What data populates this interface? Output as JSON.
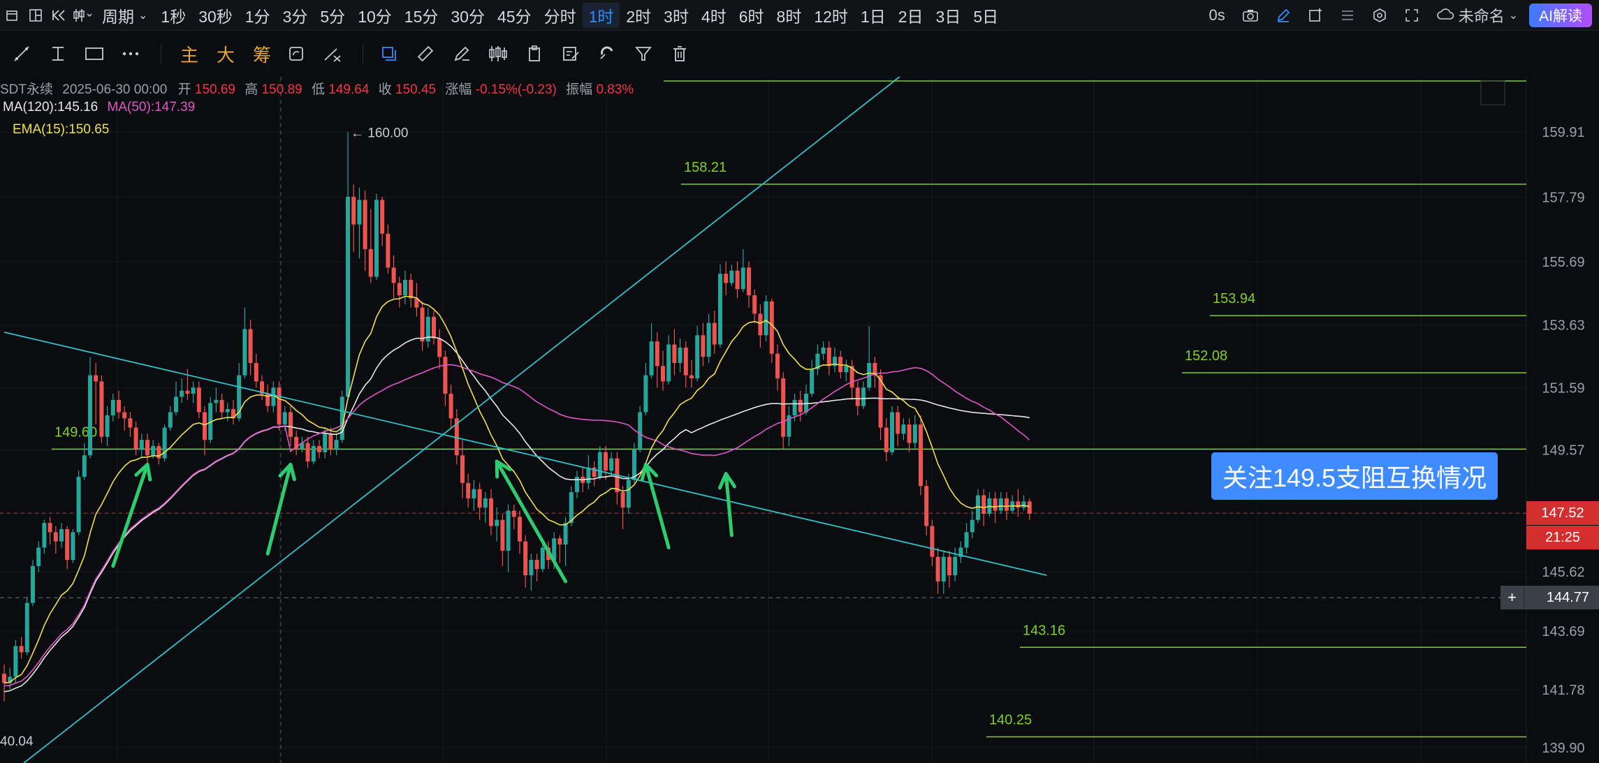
{
  "toolbar": {
    "period_label": "周期",
    "timeframes": [
      "1秒",
      "30秒",
      "1分",
      "3分",
      "5分",
      "10分",
      "15分",
      "30分",
      "45分",
      "分时",
      "1时",
      "2时",
      "3时",
      "4时",
      "6时",
      "8时",
      "12时",
      "1日",
      "2日",
      "3日",
      "5日"
    ],
    "active_timeframe": "1时",
    "latency": "0s",
    "layout_name": "未命名",
    "ai_button": "AI解读"
  },
  "drawbar": {
    "gold_labels": [
      "主",
      "大",
      "筹"
    ]
  },
  "legend": {
    "symbol": "SDT永续",
    "datetime": "2025-06-30 00:00",
    "open_label": "开",
    "open": "150.69",
    "high_label": "高",
    "high": "150.89",
    "low_label": "低",
    "low": "149.64",
    "close_label": "收",
    "close": "150.45",
    "change_label": "涨幅",
    "change": "-0.15%(-0.23)",
    "amp_label": "振幅",
    "amp": "0.83%",
    "ma120": "MA(120):145.16",
    "ma50": "MA(50):147.39",
    "ema15": "EMA(15):150.65"
  },
  "annotation": "关注149.5支阻互换情况",
  "badges": {
    "current_price": "147.52",
    "countdown": "21:25",
    "cursor_price": "144.77"
  },
  "colors": {
    "up": "#26a69a",
    "down": "#ef5350",
    "ma120": "#e8e8e8",
    "ma50": "#e056c8",
    "ema15": "#f0e14c",
    "level_line": "#7ed321",
    "trend_line": "#2fc2c9",
    "arrow": "#2ecc71"
  },
  "chart_data": {
    "type": "candlestick",
    "y_axis_ticks": [
      "159.91",
      "157.79",
      "155.69",
      "153.63",
      "151.59",
      "149.57",
      "147.52",
      "145.62",
      "143.69",
      "141.78",
      "139.90"
    ],
    "ylim": [
      139.4,
      161.7
    ],
    "high_marker": "160.00",
    "low_marker": "40.04",
    "levels": [
      {
        "label": "158.21",
        "value": 158.21
      },
      {
        "label": "153.94",
        "value": 153.94
      },
      {
        "label": "152.08",
        "value": 152.08
      },
      {
        "label": "149.60",
        "value": 149.6
      },
      {
        "label": "143.16",
        "value": 143.16
      },
      {
        "label": "140.25",
        "value": 140.25
      }
    ],
    "trend_lines": [
      {
        "from": [
          0,
          138.9
        ],
        "to": [
          157,
          161.8
        ]
      },
      {
        "from": [
          0,
          153.4
        ],
        "to": [
          182,
          145.5
        ]
      }
    ],
    "arrows": [
      {
        "from": [
          19,
          145.8
        ],
        "to": [
          25,
          149.1
        ]
      },
      {
        "from": [
          46,
          146.2
        ],
        "to": [
          50,
          149.1
        ]
      },
      {
        "from": [
          98,
          145.3
        ],
        "to": [
          86,
          149.2
        ]
      },
      {
        "from": [
          116,
          146.4
        ],
        "to": [
          112,
          149.1
        ]
      },
      {
        "from": [
          127,
          146.8
        ],
        "to": [
          126,
          148.8
        ]
      }
    ],
    "candles": [
      [
        142.3,
        142.0,
        141.4,
        142.6
      ],
      [
        142.0,
        142.2,
        141.8,
        142.5
      ],
      [
        142.2,
        143.2,
        142.0,
        143.4
      ],
      [
        143.2,
        143.0,
        142.8,
        143.5
      ],
      [
        143.0,
        144.6,
        142.9,
        144.8
      ],
      [
        144.6,
        145.8,
        144.5,
        146.0
      ],
      [
        145.8,
        146.4,
        145.6,
        146.6
      ],
      [
        146.4,
        147.2,
        146.2,
        147.3
      ],
      [
        147.2,
        146.9,
        146.5,
        147.4
      ],
      [
        146.9,
        146.6,
        146.2,
        147.1
      ],
      [
        146.6,
        147.0,
        146.4,
        147.2
      ],
      [
        147.0,
        146.0,
        145.7,
        147.1
      ],
      [
        146.0,
        146.9,
        145.9,
        147.0
      ],
      [
        146.9,
        148.7,
        146.8,
        148.9
      ],
      [
        148.7,
        149.4,
        148.6,
        149.8
      ],
      [
        149.4,
        152.0,
        149.3,
        152.6
      ],
      [
        152.0,
        151.8,
        150.4,
        152.4
      ],
      [
        151.8,
        150.0,
        149.8,
        152.0
      ],
      [
        150.0,
        150.7,
        149.7,
        151.0
      ],
      [
        150.7,
        151.2,
        150.5,
        151.4
      ],
      [
        151.2,
        150.8,
        150.6,
        151.5
      ],
      [
        150.8,
        150.6,
        150.2,
        151.0
      ],
      [
        150.6,
        150.3,
        150.0,
        150.8
      ],
      [
        150.3,
        149.6,
        149.4,
        150.5
      ],
      [
        149.6,
        149.9,
        149.3,
        150.1
      ],
      [
        149.9,
        149.4,
        149.1,
        150.1
      ],
      [
        149.4,
        149.7,
        149.3,
        149.9
      ],
      [
        149.7,
        149.3,
        149.1,
        149.8
      ],
      [
        149.3,
        150.3,
        149.2,
        150.4
      ],
      [
        150.3,
        150.8,
        150.2,
        151.0
      ],
      [
        150.8,
        151.3,
        150.7,
        151.8
      ],
      [
        151.3,
        151.5,
        151.1,
        151.9
      ],
      [
        151.5,
        151.4,
        151.2,
        152.2
      ],
      [
        151.4,
        151.6,
        151.1,
        151.8
      ],
      [
        151.6,
        150.8,
        150.6,
        151.8
      ],
      [
        150.8,
        149.9,
        149.4,
        151.0
      ],
      [
        149.9,
        151.1,
        149.8,
        151.3
      ],
      [
        151.1,
        151.2,
        150.8,
        151.6
      ],
      [
        151.2,
        150.8,
        150.6,
        151.4
      ],
      [
        150.8,
        150.9,
        150.5,
        151.1
      ],
      [
        150.9,
        150.6,
        150.4,
        151.2
      ],
      [
        150.6,
        152.0,
        150.5,
        152.4
      ],
      [
        152.0,
        153.5,
        151.9,
        154.2
      ],
      [
        153.5,
        152.4,
        152.0,
        153.8
      ],
      [
        152.4,
        151.8,
        151.6,
        152.7
      ],
      [
        151.8,
        151.4,
        151.2,
        152.0
      ],
      [
        151.4,
        151.0,
        150.8,
        151.7
      ],
      [
        151.0,
        151.6,
        150.8,
        151.8
      ],
      [
        151.6,
        150.4,
        150.2,
        151.8
      ],
      [
        150.4,
        150.8,
        150.2,
        151.0
      ],
      [
        150.8,
        150.0,
        149.7,
        151.0
      ],
      [
        150.0,
        149.6,
        149.4,
        150.2
      ],
      [
        149.6,
        149.8,
        149.5,
        150.0
      ],
      [
        149.8,
        149.2,
        149.0,
        150.0
      ],
      [
        149.2,
        149.7,
        149.1,
        149.9
      ],
      [
        149.7,
        149.5,
        149.3,
        149.9
      ],
      [
        149.5,
        150.1,
        149.3,
        150.3
      ],
      [
        150.1,
        149.6,
        149.4,
        150.3
      ],
      [
        149.6,
        149.9,
        149.4,
        150.1
      ],
      [
        149.9,
        151.3,
        149.8,
        151.5
      ],
      [
        151.3,
        157.8,
        151.2,
        159.9
      ],
      [
        157.8,
        156.9,
        156.0,
        158.2
      ],
      [
        156.9,
        157.7,
        155.8,
        158.1
      ],
      [
        157.7,
        156.1,
        155.4,
        158.0
      ],
      [
        156.1,
        155.2,
        155.0,
        157.4
      ],
      [
        155.2,
        157.7,
        155.1,
        157.9
      ],
      [
        157.7,
        156.6,
        156.2,
        157.8
      ],
      [
        156.6,
        155.5,
        155.3,
        156.9
      ],
      [
        155.5,
        155.0,
        154.5,
        155.9
      ],
      [
        155.0,
        154.6,
        154.2,
        155.2
      ],
      [
        154.6,
        155.1,
        154.3,
        155.4
      ],
      [
        155.1,
        154.5,
        154.2,
        155.3
      ],
      [
        154.5,
        154.2,
        153.9,
        155.0
      ],
      [
        154.2,
        153.1,
        152.8,
        154.4
      ],
      [
        153.1,
        153.9,
        152.9,
        154.2
      ],
      [
        153.9,
        153.2,
        153.0,
        154.1
      ],
      [
        153.2,
        152.6,
        152.2,
        153.5
      ],
      [
        152.6,
        151.4,
        151.0,
        152.8
      ],
      [
        151.4,
        150.6,
        150.3,
        151.7
      ],
      [
        150.6,
        149.4,
        149.1,
        150.9
      ],
      [
        149.4,
        148.5,
        148.0,
        149.9
      ],
      [
        148.5,
        148.0,
        147.7,
        148.8
      ],
      [
        148.0,
        148.3,
        147.6,
        148.6
      ],
      [
        148.3,
        147.7,
        147.3,
        148.5
      ],
      [
        147.7,
        148.0,
        147.2,
        148.2
      ],
      [
        148.0,
        147.1,
        146.8,
        148.3
      ],
      [
        147.1,
        147.3,
        146.6,
        147.7
      ],
      [
        147.3,
        146.3,
        145.8,
        147.5
      ],
      [
        146.3,
        147.6,
        145.6,
        147.8
      ],
      [
        147.6,
        147.4,
        147.0,
        147.8
      ],
      [
        147.4,
        146.6,
        146.2,
        147.6
      ],
      [
        146.6,
        145.5,
        145.1,
        146.8
      ],
      [
        145.5,
        146.0,
        145.0,
        146.2
      ],
      [
        146.0,
        145.7,
        145.3,
        146.2
      ],
      [
        145.7,
        146.4,
        145.6,
        146.6
      ],
      [
        146.4,
        146.0,
        145.7,
        146.6
      ],
      [
        146.0,
        146.7,
        145.7,
        146.9
      ],
      [
        146.7,
        146.5,
        145.9,
        146.8
      ],
      [
        146.5,
        147.2,
        145.8,
        147.4
      ],
      [
        147.2,
        148.2,
        147.1,
        148.4
      ],
      [
        148.2,
        148.7,
        148.0,
        148.9
      ],
      [
        148.7,
        148.5,
        148.2,
        149.0
      ],
      [
        148.5,
        149.0,
        148.3,
        149.4
      ],
      [
        149.0,
        148.7,
        148.4,
        149.2
      ],
      [
        148.7,
        149.5,
        148.6,
        149.7
      ],
      [
        149.5,
        148.9,
        148.6,
        149.7
      ],
      [
        148.9,
        149.3,
        148.7,
        149.5
      ],
      [
        149.3,
        148.2,
        147.8,
        149.5
      ],
      [
        148.2,
        147.7,
        147.0,
        148.4
      ],
      [
        147.7,
        148.6,
        147.5,
        148.8
      ],
      [
        148.6,
        149.6,
        148.5,
        149.8
      ],
      [
        149.6,
        150.8,
        149.5,
        151.0
      ],
      [
        150.8,
        152.0,
        150.7,
        152.4
      ],
      [
        152.0,
        153.1,
        151.9,
        153.7
      ],
      [
        153.1,
        152.3,
        151.6,
        153.4
      ],
      [
        152.3,
        151.8,
        151.5,
        152.8
      ],
      [
        151.8,
        153.0,
        151.7,
        153.3
      ],
      [
        153.0,
        152.4,
        152.0,
        153.5
      ],
      [
        152.4,
        152.9,
        152.1,
        153.2
      ],
      [
        152.9,
        152.0,
        151.6,
        153.1
      ],
      [
        152.0,
        151.9,
        151.6,
        152.5
      ],
      [
        151.9,
        153.3,
        151.8,
        153.6
      ],
      [
        153.3,
        152.6,
        152.3,
        153.7
      ],
      [
        152.6,
        153.7,
        152.4,
        154.0
      ],
      [
        153.7,
        153.0,
        152.7,
        154.1
      ],
      [
        153.0,
        155.3,
        152.9,
        155.6
      ],
      [
        155.3,
        155.0,
        154.6,
        155.7
      ],
      [
        155.0,
        155.4,
        154.9,
        155.6
      ],
      [
        155.4,
        154.8,
        154.5,
        155.7
      ],
      [
        154.8,
        155.5,
        154.7,
        156.1
      ],
      [
        155.5,
        154.6,
        154.2,
        155.7
      ],
      [
        154.6,
        154.0,
        153.7,
        154.8
      ],
      [
        154.0,
        153.3,
        152.9,
        154.3
      ],
      [
        153.3,
        154.4,
        153.1,
        154.6
      ],
      [
        154.4,
        152.7,
        152.4,
        154.5
      ],
      [
        152.7,
        151.9,
        151.5,
        153.0
      ],
      [
        151.9,
        150.0,
        149.6,
        152.1
      ],
      [
        150.0,
        150.7,
        149.7,
        151.0
      ],
      [
        150.7,
        151.2,
        150.5,
        151.4
      ],
      [
        151.2,
        150.8,
        150.5,
        151.5
      ],
      [
        150.8,
        151.4,
        150.7,
        151.7
      ],
      [
        151.4,
        152.2,
        151.3,
        152.5
      ],
      [
        152.2,
        152.7,
        152.0,
        153.0
      ],
      [
        152.7,
        152.9,
        152.5,
        153.1
      ],
      [
        152.9,
        152.3,
        152.0,
        153.1
      ],
      [
        152.3,
        152.6,
        152.1,
        152.9
      ],
      [
        152.6,
        152.1,
        151.9,
        152.8
      ],
      [
        152.1,
        152.3,
        151.8,
        152.5
      ],
      [
        152.3,
        151.6,
        151.2,
        152.5
      ],
      [
        151.6,
        151.0,
        150.7,
        151.8
      ],
      [
        151.0,
        151.6,
        150.9,
        151.8
      ],
      [
        151.6,
        152.4,
        151.5,
        153.6
      ],
      [
        152.4,
        152.0,
        151.6,
        152.6
      ],
      [
        152.0,
        150.3,
        149.9,
        152.2
      ],
      [
        150.3,
        149.5,
        149.2,
        150.6
      ],
      [
        149.5,
        150.8,
        149.4,
        151.0
      ],
      [
        150.8,
        150.1,
        149.7,
        151.0
      ],
      [
        150.1,
        150.4,
        149.9,
        150.6
      ],
      [
        150.4,
        149.8,
        149.5,
        150.6
      ],
      [
        149.8,
        150.4,
        149.6,
        150.7
      ],
      [
        150.4,
        148.4,
        148.1,
        150.7
      ],
      [
        148.4,
        147.1,
        146.8,
        148.6
      ],
      [
        147.1,
        146.1,
        145.8,
        147.3
      ],
      [
        146.1,
        145.3,
        144.9,
        146.4
      ],
      [
        145.3,
        146.1,
        144.9,
        146.3
      ],
      [
        146.1,
        145.5,
        145.1,
        146.3
      ],
      [
        145.5,
        146.1,
        145.3,
        146.4
      ],
      [
        146.1,
        146.4,
        145.9,
        146.6
      ],
      [
        146.4,
        146.9,
        146.2,
        147.2
      ],
      [
        146.9,
        147.3,
        146.7,
        147.6
      ],
      [
        147.3,
        148.1,
        147.2,
        148.3
      ],
      [
        148.1,
        147.5,
        147.1,
        148.3
      ],
      [
        147.5,
        148.0,
        147.4,
        148.2
      ],
      [
        148.0,
        147.6,
        147.2,
        148.2
      ],
      [
        147.6,
        148.0,
        147.5,
        148.2
      ],
      [
        148.0,
        147.6,
        147.3,
        148.2
      ],
      [
        147.6,
        147.9,
        147.5,
        148.1
      ],
      [
        147.9,
        147.7,
        147.4,
        148.3
      ],
      [
        147.7,
        147.9,
        147.6,
        148.1
      ],
      [
        147.9,
        147.5,
        147.3,
        148.0
      ]
    ]
  }
}
